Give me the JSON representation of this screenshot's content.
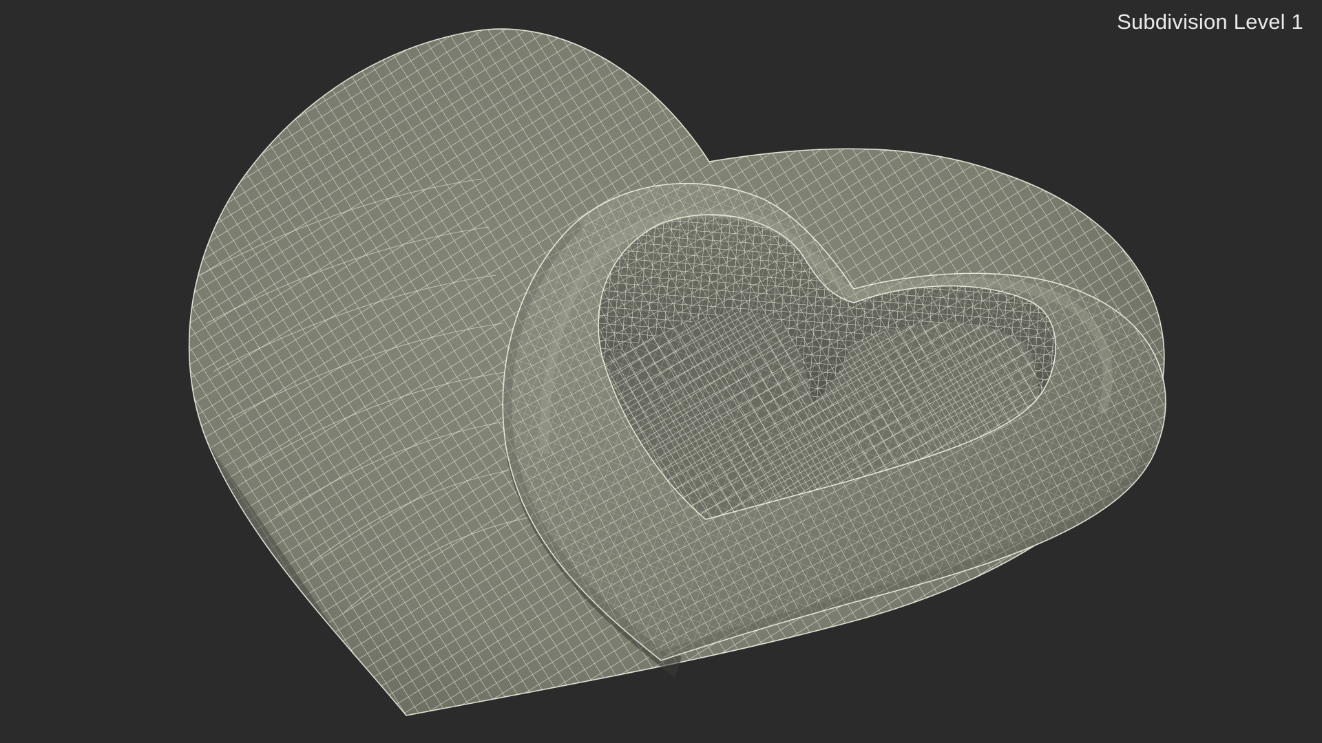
{
  "viewport": {
    "background": "#2b2b2b",
    "label": "Subdivision Level 1"
  },
  "model": {
    "surface_color": "#7c7e72",
    "wire_color": "#f2f0e2",
    "shadow_color": "#4a4c44",
    "highlight_color": "#9a9c8f"
  }
}
